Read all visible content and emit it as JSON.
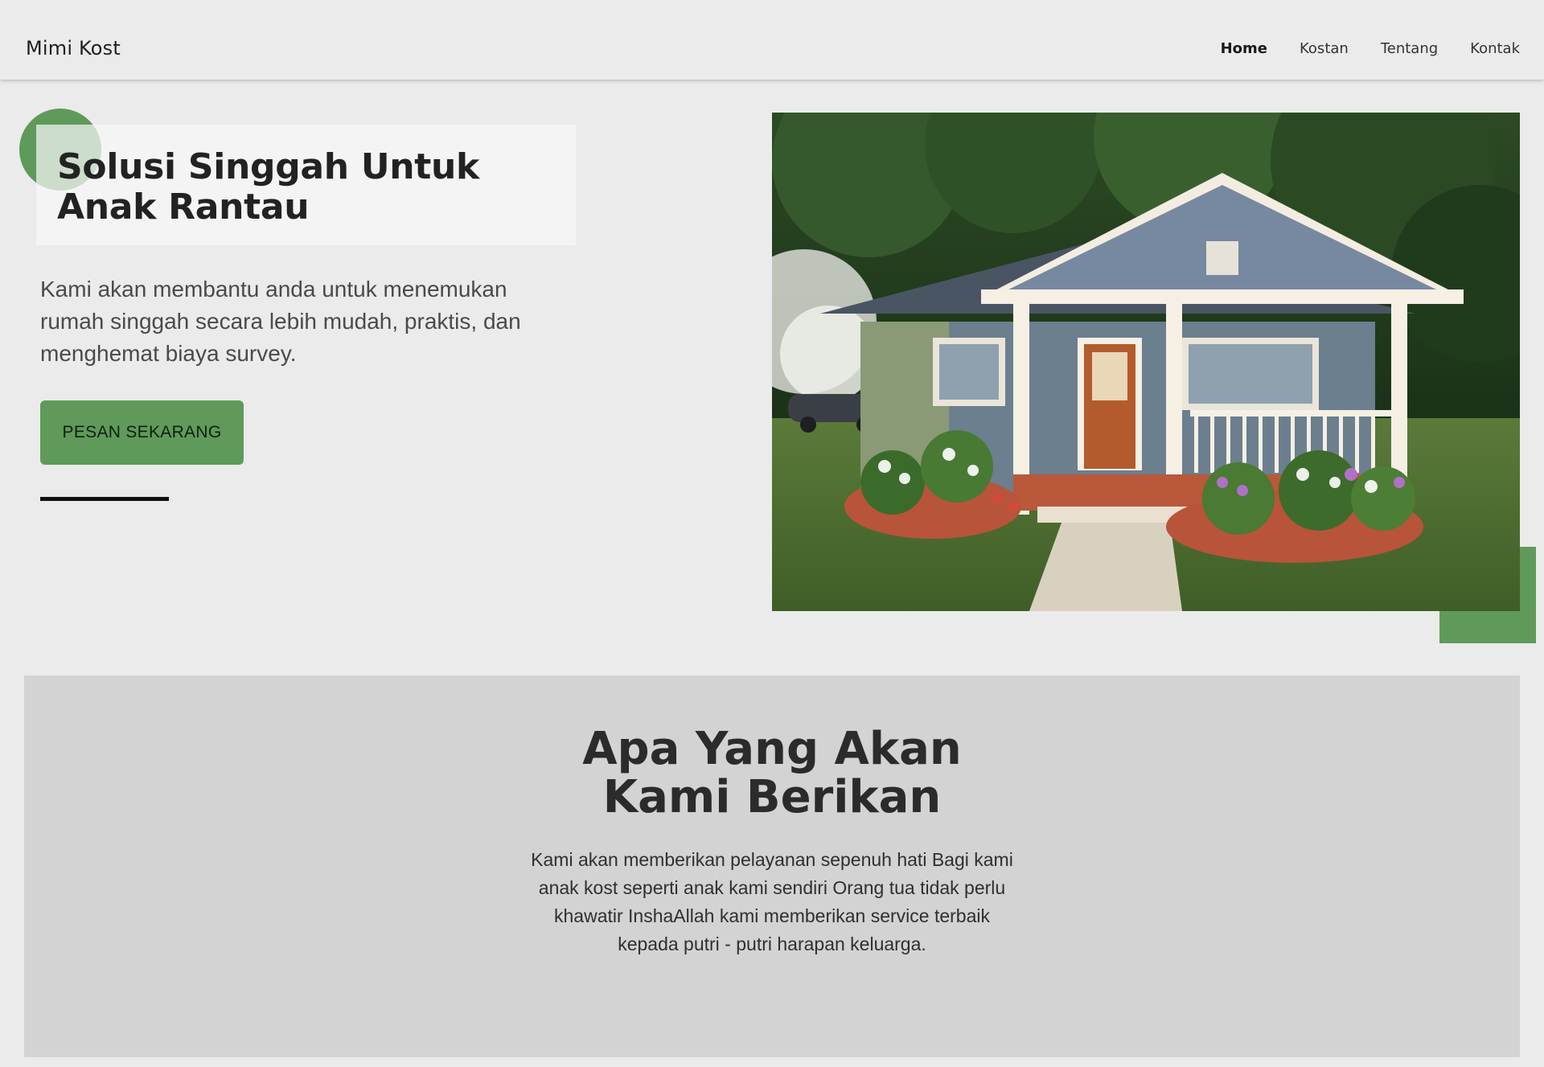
{
  "navbar": {
    "brand": "Mimi Kost",
    "links": [
      {
        "label": "Home",
        "active": true
      },
      {
        "label": "Kostan",
        "active": false
      },
      {
        "label": "Tentang",
        "active": false
      },
      {
        "label": "Kontak",
        "active": false
      }
    ]
  },
  "hero": {
    "title": "Solusi Singgah Untuk Anak Rantau",
    "description": "Kami akan membantu anda untuk menemukan rumah singgah secara lebih mudah, praktis, dan menghemat biaya survey.",
    "cta_label": "PESAN SEKARANG",
    "image_alt": "Rumah kost"
  },
  "services": {
    "title_line1": "Apa Yang Akan",
    "title_line2": "Kami Berikan",
    "description": "Kami akan memberikan pelayanan sepenuh hati Bagi kami anak kost seperti anak kami sendiri Orang tua tidak perlu khawatir InshaAllah kami memberikan service terbaik kepada putri - putri harapan keluarga."
  },
  "colors": {
    "accent_green": "#5f9a5a",
    "page_bg": "#ebebeb",
    "section_bg": "#d3d3d3"
  }
}
